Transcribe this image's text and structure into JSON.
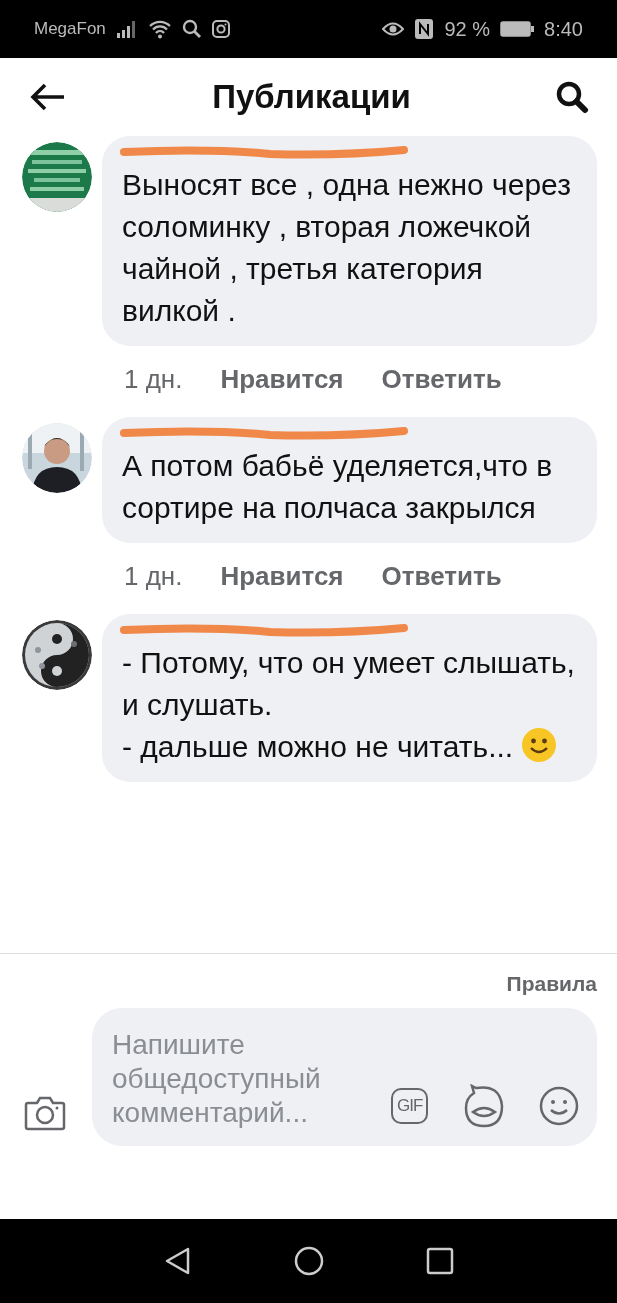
{
  "status_bar": {
    "carrier": "MegaFon",
    "battery": "92 %",
    "time": "8:40"
  },
  "header": {
    "title": "Публикации"
  },
  "comments": [
    {
      "name_redacted": true,
      "text": "Выносят все , одна нежно через соломинку , вторая ложечкой чайной , третья категория вилкой .",
      "time": "1 дн.",
      "like": "Нравится",
      "reply": "Ответить"
    },
    {
      "name_redacted": true,
      "text": "А потом бабьё уделяется,что в сортире на полчаса закрылся",
      "time": "1 дн.",
      "like": "Нравится",
      "reply": "Ответить"
    },
    {
      "name_redacted": true,
      "text": "- Потому, что он умеет слышать, и слушать.\n- дальше можно не читать...",
      "ends_with_emoji": true
    }
  ],
  "rules_link": "Правила",
  "composer": {
    "placeholder": "Напишите общедоступный комментарий...",
    "gif_label": "GIF"
  }
}
